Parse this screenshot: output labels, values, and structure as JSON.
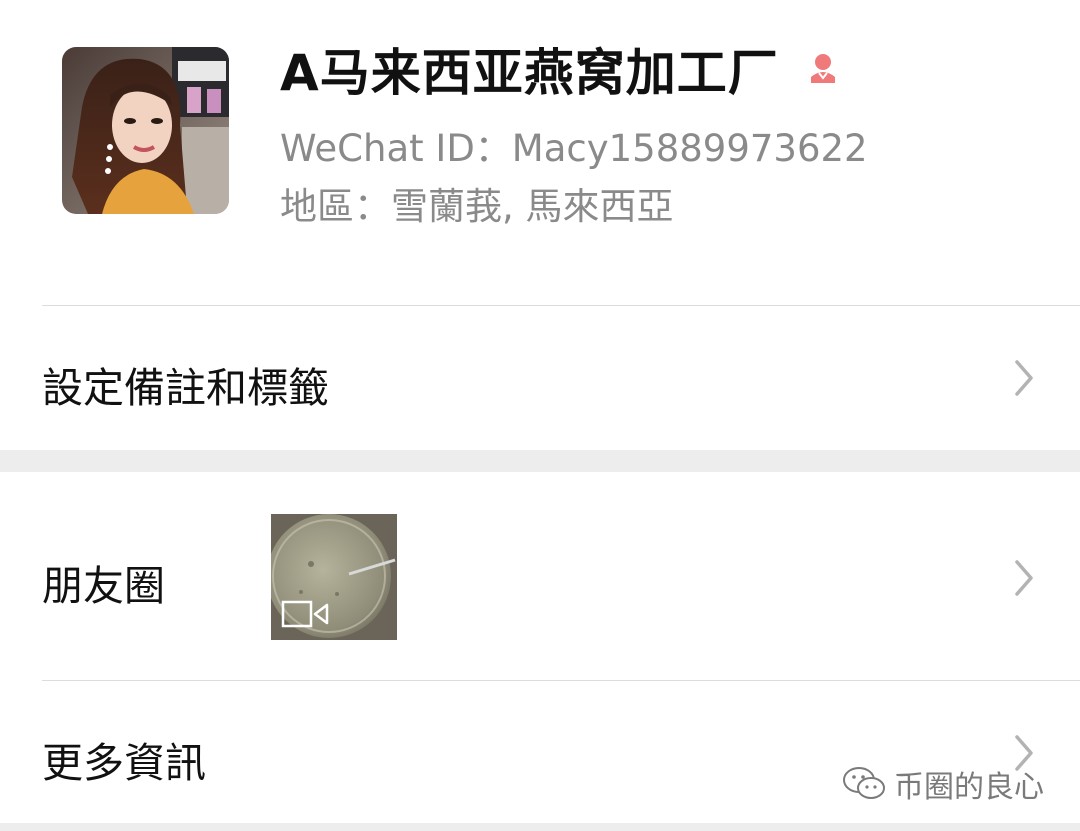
{
  "profile": {
    "name": "A马来西亚燕窝加工厂",
    "wechat_id": "WeChat ID：Macy15889973622",
    "region": "地區：雪蘭莪, 馬來西亞",
    "avatar": "avatar-photo",
    "gender_icon": "female-icon",
    "gender_color": "#f0797a"
  },
  "rows": {
    "remarks_label": "設定備註和標籤",
    "moments_label": "朋友圈",
    "more_info_label": "更多資訊"
  },
  "moments": {
    "thumbnail": "video-thumbnail",
    "thumbnail_icon": "video-camera-icon"
  },
  "watermark": {
    "text": "币圈的良心",
    "icon": "wechat-official-account-icon"
  },
  "colors": {
    "secondary_text": "#8a8a8a",
    "divider": "#dcdcdc",
    "section_gap": "#ededed",
    "chevron": "#b3b3b3"
  }
}
